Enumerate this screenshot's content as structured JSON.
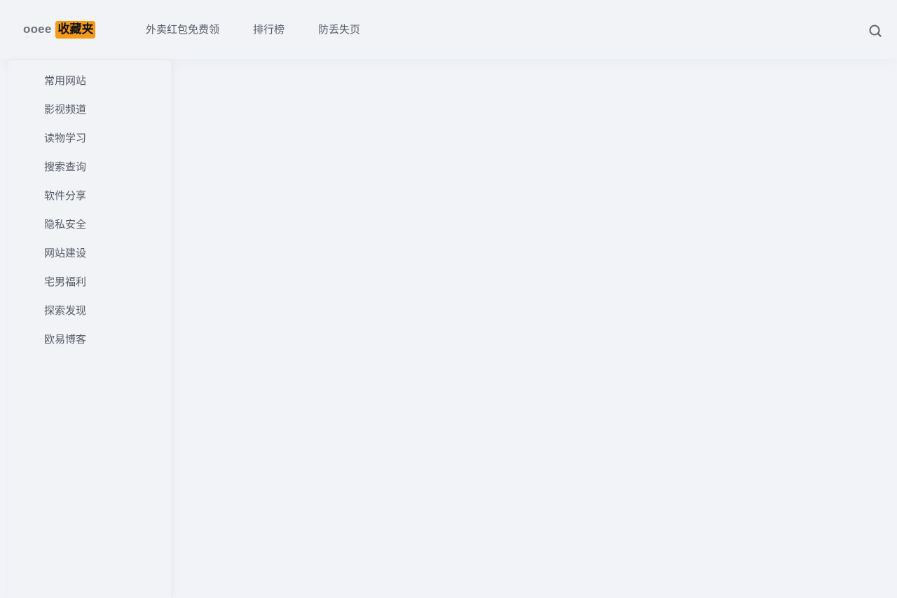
{
  "header": {
    "logo": {
      "prefix": "ooee",
      "badge": "收藏夹",
      "badge_color": "#f79a1a"
    },
    "nav": [
      {
        "label": "外卖红包免费领"
      },
      {
        "label": "排行榜"
      },
      {
        "label": "防丢失页"
      }
    ],
    "search_icon": "search-icon"
  },
  "sidebar": {
    "items": [
      {
        "label": "常用网站"
      },
      {
        "label": "影视频道"
      },
      {
        "label": "读物学习"
      },
      {
        "label": "搜索查询"
      },
      {
        "label": "软件分享"
      },
      {
        "label": "隐私安全"
      },
      {
        "label": "网站建设"
      },
      {
        "label": "宅男福利"
      },
      {
        "label": "探索发现"
      },
      {
        "label": "欧易博客"
      }
    ]
  },
  "theme": {
    "background": "#f1f3f8",
    "text": "#555b66",
    "accent": "#f79a1a"
  }
}
